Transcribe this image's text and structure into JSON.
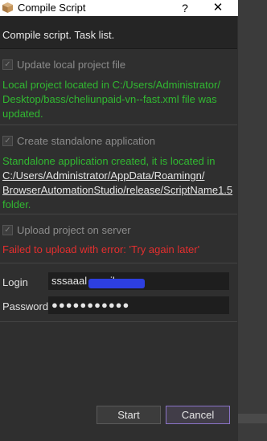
{
  "window": {
    "title": "Compile Script",
    "help_glyph": "?",
    "close_glyph": "✕",
    "app_icon": "package-box-icon"
  },
  "header": {
    "label": "Compile script. Task list."
  },
  "tasks": [
    {
      "label": "Update local project file",
      "checked": true,
      "message_parts": [
        "Local project located in C:/Users/Administrator/",
        "Desktop/bass/cheliunpaid-vn--fast.xml file was",
        "updated."
      ],
      "status": "success"
    },
    {
      "label": "Create standalone application",
      "checked": true,
      "message_lines": [
        "Standalone application created, it is located in"
      ],
      "message_links": [
        "C:/Users/Administrator/AppData/Roamingn/",
        "BrowserAutomationStudio/release/ScriptName1.5"
      ],
      "message_tail": "folder.",
      "status": "success"
    },
    {
      "label": "Upload project on server",
      "checked": true,
      "message": "Failed to upload with error: 'Try again later'",
      "status": "error"
    }
  ],
  "form": {
    "login_label": "Login",
    "login_value": "sssaaal            gmail.com",
    "password_label": "Password",
    "password_value": "●●●●●●●●●●●"
  },
  "buttons": {
    "start": "Start",
    "cancel": "Cancel"
  },
  "colors": {
    "success": "#31b931",
    "error": "#e42f2f",
    "accent": "#8a73c7"
  }
}
